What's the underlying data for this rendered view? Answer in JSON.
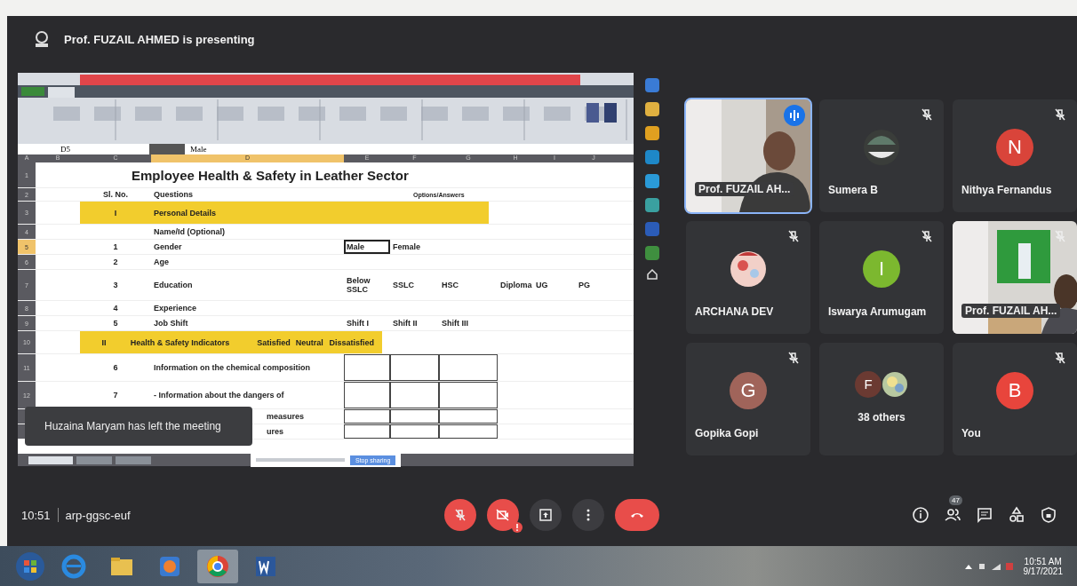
{
  "header": {
    "presenter_text": "Prof. FUZAIL AHMED is presenting"
  },
  "spreadsheet": {
    "name_box": "D5",
    "formula": "Male",
    "columns": [
      {
        "label": "A",
        "selected": false
      },
      {
        "label": "B",
        "selected": false
      },
      {
        "label": "C",
        "selected": false
      },
      {
        "label": "D",
        "selected": true
      },
      {
        "label": "E",
        "selected": false
      },
      {
        "label": "F",
        "selected": false
      },
      {
        "label": "G",
        "selected": false
      },
      {
        "label": "H",
        "selected": false
      },
      {
        "label": "I",
        "selected": false
      },
      {
        "label": "J",
        "selected": false
      }
    ],
    "rows": [
      {
        "n": "1",
        "kind": "title",
        "selected": false,
        "question": "Employee Health & Safety in Leather Sector"
      },
      {
        "n": "2",
        "kind": "header",
        "selected": false,
        "sl": "Sl. No.",
        "question": "Questions",
        "answers_label": "Options/Answers"
      },
      {
        "n": "3",
        "kind": "section",
        "selected": false,
        "sl": "I",
        "question": "Personal Details"
      },
      {
        "n": "4",
        "kind": "question",
        "selected": false,
        "question": "Name/Id (Optional)"
      },
      {
        "n": "5",
        "kind": "question",
        "selected": true,
        "sl": "1",
        "question": "Gender",
        "options": [
          {
            "text": "Male",
            "selected": true
          },
          {
            "text": "Female",
            "selected": false
          }
        ]
      },
      {
        "n": "6",
        "kind": "question",
        "selected": false,
        "sl": "2",
        "question": "Age"
      },
      {
        "n": "7",
        "kind": "question",
        "selected": false,
        "sl": "3",
        "question": "Education",
        "options": [
          {
            "text": "Below SSLC",
            "selected": false
          },
          {
            "text": "SSLC",
            "selected": false
          },
          {
            "text": "HSC",
            "selected": false
          },
          {
            "text": "Diploma",
            "selected": false
          },
          {
            "text": "UG",
            "selected": false
          },
          {
            "text": "PG",
            "selected": false
          }
        ]
      },
      {
        "n": "8",
        "kind": "question",
        "selected": false,
        "sl": "4",
        "question": "Experience"
      },
      {
        "n": "9",
        "kind": "question",
        "selected": false,
        "sl": "5",
        "question": "Job Shift",
        "options": [
          {
            "text": "Shift I",
            "selected": false
          },
          {
            "text": "Shift II",
            "selected": false
          },
          {
            "text": "Shift III",
            "selected": false
          }
        ]
      },
      {
        "n": "10",
        "kind": "section",
        "selected": false,
        "sl": "II",
        "question": "Health & Safety Indicators",
        "options": [
          {
            "text": "Satisfied",
            "selected": false
          },
          {
            "text": "Neutral",
            "selected": false
          },
          {
            "text": "Dissatisfied",
            "selected": false
          }
        ]
      },
      {
        "n": "11",
        "kind": "boxed",
        "selected": false,
        "sl": "6",
        "question": "Information on the chemical composition"
      },
      {
        "n": "12",
        "kind": "boxed",
        "selected": false,
        "sl": "7",
        "question": "- Information about the dangers of"
      },
      {
        "kind": "boxed",
        "question": "measures"
      },
      {
        "kind": "boxed",
        "question": "ures"
      }
    ],
    "stop_sharing": "Stop sharing"
  },
  "toast": "Huzaina Maryam has left the meeting",
  "tiles": [
    {
      "name": "Prof. FUZAIL AH...",
      "kind": "video",
      "speaking": true,
      "muted": false
    },
    {
      "name": "Sumera B",
      "speaking": false,
      "muted": true
    },
    {
      "name": "Nithya Fernandus",
      "kind": "letter",
      "initial": "N",
      "color": "#d9443a",
      "speaking": false,
      "muted": true
    },
    {
      "name": "ARCHANA DEV",
      "speaking": false,
      "muted": true
    },
    {
      "name": "Iswarya Arumugam",
      "kind": "letter",
      "initial": "I",
      "color": "#7cb82f",
      "speaking": false,
      "muted": true
    },
    {
      "name": "Prof. FUZAIL AH...",
      "kind": "video",
      "speaking": false,
      "muted": true
    },
    {
      "name": "Gopika Gopi",
      "kind": "letter",
      "initial": "G",
      "color": "#a0645a",
      "speaking": false,
      "muted": true
    },
    {
      "name": "38 others",
      "kind": "others",
      "initial": "F",
      "color": "#6b3a32",
      "speaking": false,
      "muted": false
    },
    {
      "name": "You",
      "kind": "letter",
      "initial": "B",
      "color": "#e8453c",
      "speaking": false,
      "muted": true
    }
  ],
  "bottom_bar": {
    "time": "10:51",
    "meeting_code": "arp-ggsc-euf",
    "people_count": "47"
  },
  "taskbar": {
    "time": "10:51 AM",
    "date": "9/17/2021"
  }
}
